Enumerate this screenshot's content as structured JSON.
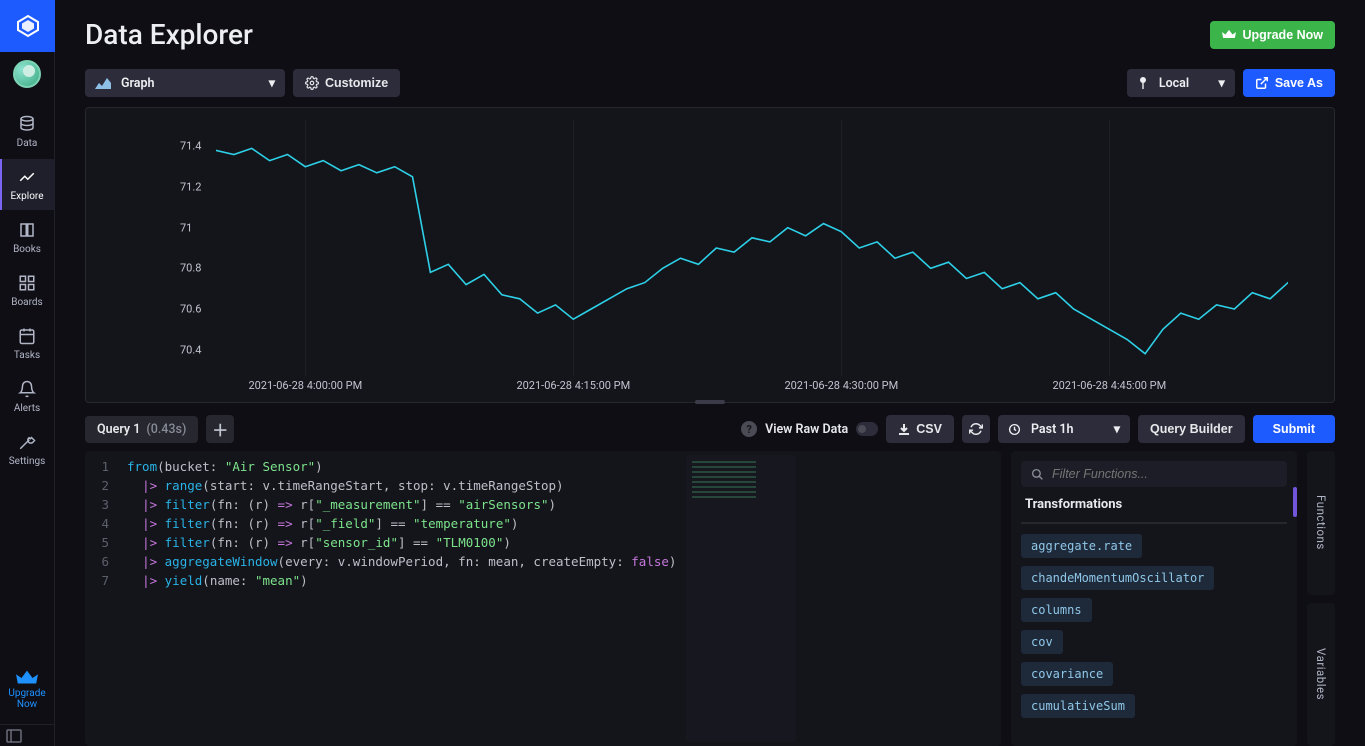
{
  "header": {
    "title": "Data Explorer",
    "upgrade_label": "Upgrade Now"
  },
  "sidebar": {
    "items": [
      {
        "label": "Data"
      },
      {
        "label": "Explore"
      },
      {
        "label": "Books"
      },
      {
        "label": "Boards"
      },
      {
        "label": "Tasks"
      },
      {
        "label": "Alerts"
      },
      {
        "label": "Settings"
      }
    ],
    "upgrade_label": "Upgrade Now"
  },
  "toolbar": {
    "view_type": "Graph",
    "customize_label": "Customize",
    "timezone": "Local",
    "save_as_label": "Save As"
  },
  "query_bar": {
    "tab_label": "Query 1",
    "tab_time": "(0.43s)",
    "view_raw_label": "View Raw Data",
    "csv_label": "CSV",
    "time_range": "Past 1h",
    "query_builder_label": "Query Builder",
    "submit_label": "Submit"
  },
  "code": {
    "line_nums": [
      "1",
      "2",
      "3",
      "4",
      "5",
      "6",
      "7"
    ]
  },
  "functions": {
    "search_placeholder": "Filter Functions...",
    "section": "Transformations",
    "items": [
      "aggregate.rate",
      "chandeMomentumOscillator",
      "columns",
      "cov",
      "covariance",
      "cumulativeSum"
    ]
  },
  "side_tabs": {
    "functions": "Functions",
    "variables": "Variables"
  },
  "chart_data": {
    "type": "line",
    "title": "",
    "xlabel": "",
    "ylabel": "",
    "ylim": [
      70.3,
      71.5
    ],
    "y_ticks": [
      71.4,
      71.2,
      71,
      70.8,
      70.6,
      70.4
    ],
    "x_ticks": [
      "2021-06-28 4:00:00 PM",
      "2021-06-28 4:15:00 PM",
      "2021-06-28 4:30:00 PM",
      "2021-06-28 4:45:00 PM"
    ],
    "x_range_minutes": [
      0,
      60
    ],
    "x_tick_minutes": [
      5,
      20,
      35,
      50
    ],
    "series": [
      {
        "name": "temperature TLM0100",
        "color": "#2dd0e6",
        "points": [
          [
            -5,
            71.42
          ],
          [
            -4,
            71.38
          ],
          [
            -3,
            71.42
          ],
          [
            -2,
            71.37
          ],
          [
            -1,
            71.4
          ],
          [
            0,
            71.38
          ],
          [
            1,
            71.36
          ],
          [
            2,
            71.39
          ],
          [
            3,
            71.33
          ],
          [
            4,
            71.36
          ],
          [
            5,
            71.3
          ],
          [
            6,
            71.33
          ],
          [
            7,
            71.28
          ],
          [
            8,
            71.31
          ],
          [
            9,
            71.27
          ],
          [
            10,
            71.3
          ],
          [
            11,
            71.25
          ],
          [
            12,
            70.78
          ],
          [
            13,
            70.82
          ],
          [
            14,
            70.72
          ],
          [
            15,
            70.77
          ],
          [
            16,
            70.67
          ],
          [
            17,
            70.65
          ],
          [
            18,
            70.58
          ],
          [
            19,
            70.62
          ],
          [
            20,
            70.55
          ],
          [
            21,
            70.6
          ],
          [
            22,
            70.65
          ],
          [
            23,
            70.7
          ],
          [
            24,
            70.73
          ],
          [
            25,
            70.8
          ],
          [
            26,
            70.85
          ],
          [
            27,
            70.82
          ],
          [
            28,
            70.9
          ],
          [
            29,
            70.88
          ],
          [
            30,
            70.95
          ],
          [
            31,
            70.93
          ],
          [
            32,
            71.0
          ],
          [
            33,
            70.96
          ],
          [
            34,
            71.02
          ],
          [
            35,
            70.98
          ],
          [
            36,
            70.9
          ],
          [
            37,
            70.93
          ],
          [
            38,
            70.85
          ],
          [
            39,
            70.88
          ],
          [
            40,
            70.8
          ],
          [
            41,
            70.83
          ],
          [
            42,
            70.75
          ],
          [
            43,
            70.78
          ],
          [
            44,
            70.7
          ],
          [
            45,
            70.73
          ],
          [
            46,
            70.65
          ],
          [
            47,
            70.68
          ],
          [
            48,
            70.6
          ],
          [
            49,
            70.55
          ],
          [
            50,
            70.5
          ],
          [
            51,
            70.45
          ],
          [
            52,
            70.38
          ],
          [
            53,
            70.5
          ],
          [
            54,
            70.58
          ],
          [
            55,
            70.55
          ],
          [
            56,
            70.62
          ],
          [
            57,
            70.6
          ],
          [
            58,
            70.68
          ],
          [
            59,
            70.65
          ],
          [
            60,
            70.73
          ],
          [
            61,
            70.78
          ],
          [
            62,
            70.72
          ],
          [
            63,
            70.8
          ]
        ]
      }
    ]
  }
}
